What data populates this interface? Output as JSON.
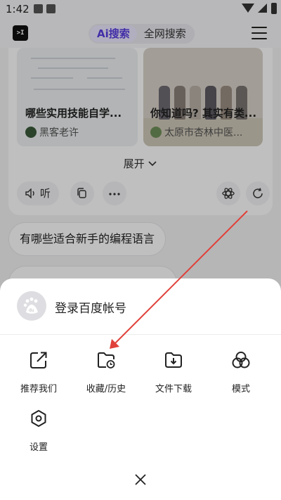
{
  "status_bar": {
    "time": "1:42"
  },
  "header": {
    "logo_text": ">I",
    "tabs": [
      {
        "label": "Ai搜索",
        "active": true
      },
      {
        "label": "全网搜索",
        "active": false
      }
    ],
    "menu_icon": "hamburger-icon"
  },
  "results": {
    "cards": [
      {
        "title": "哪些实用技能自学...",
        "author": "黑客老许"
      },
      {
        "title": "你知道吗? 其实有类...",
        "author": "太原市杏林中医..."
      }
    ],
    "expand_label": "展开",
    "actions": {
      "listen_label": "听"
    }
  },
  "suggestions": [
    "有哪些适合新手的编程语言"
  ],
  "sheet": {
    "login_label": "登录百度帐号",
    "items": [
      {
        "label": "推荐我们",
        "icon": "share-icon"
      },
      {
        "label": "收藏/历史",
        "icon": "favorites-history-icon"
      },
      {
        "label": "文件下载",
        "icon": "download-folder-icon"
      },
      {
        "label": "模式",
        "icon": "mode-icon"
      },
      {
        "label": "设置",
        "icon": "settings-icon"
      }
    ],
    "close_icon": "close-icon"
  },
  "colors": {
    "accent": "#5a3fe0",
    "annotation_arrow": "#e0413a"
  }
}
